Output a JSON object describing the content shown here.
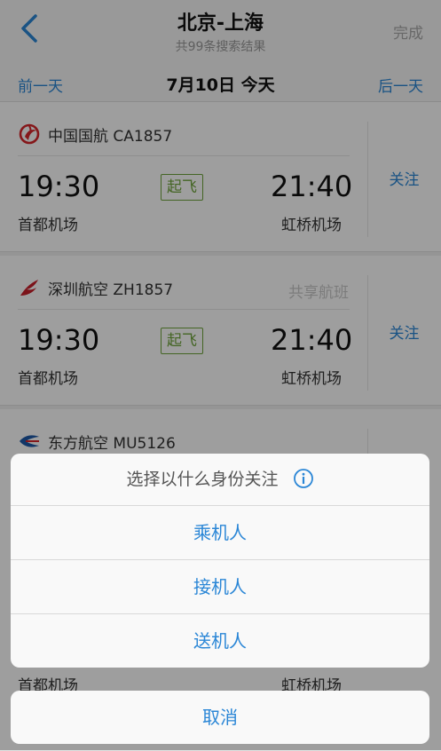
{
  "header": {
    "title": "北京-上海",
    "subtitle": "共99条搜索结果",
    "done_label": "完成"
  },
  "datebar": {
    "prev_label": "前一天",
    "current_date": "7月10日 今天",
    "next_label": "后一天"
  },
  "flights": [
    {
      "airline": "中国国航 CA1857",
      "logo": "air-china-logo",
      "dep_time": "19:30",
      "arr_time": "21:40",
      "status": "起飞",
      "dep_airport": "首都机场",
      "arr_airport": "虹桥机场",
      "follow_label": "关注",
      "shared": ""
    },
    {
      "airline": "深圳航空 ZH1857",
      "logo": "shenzhen-airlines-logo",
      "dep_time": "19:30",
      "arr_time": "21:40",
      "status": "起飞",
      "dep_airport": "首都机场",
      "arr_airport": "虹桥机场",
      "follow_label": "关注",
      "shared": "共享航班"
    },
    {
      "airline": "东方航空 MU5126",
      "logo": "china-eastern-logo",
      "dep_airport": "首都机场",
      "arr_airport": "虹桥机场"
    }
  ],
  "action_sheet": {
    "title": "选择以什么身份关注",
    "info_icon": "info-icon",
    "options": [
      "乘机人",
      "接机人",
      "送机人"
    ],
    "cancel_label": "取消"
  },
  "colors": {
    "accent": "#2a86d6",
    "status_green": "#6fa43a",
    "air_china_red": "#d7262b",
    "shenzhen_red": "#c8202a",
    "eastern_blue": "#1d5aa8"
  }
}
